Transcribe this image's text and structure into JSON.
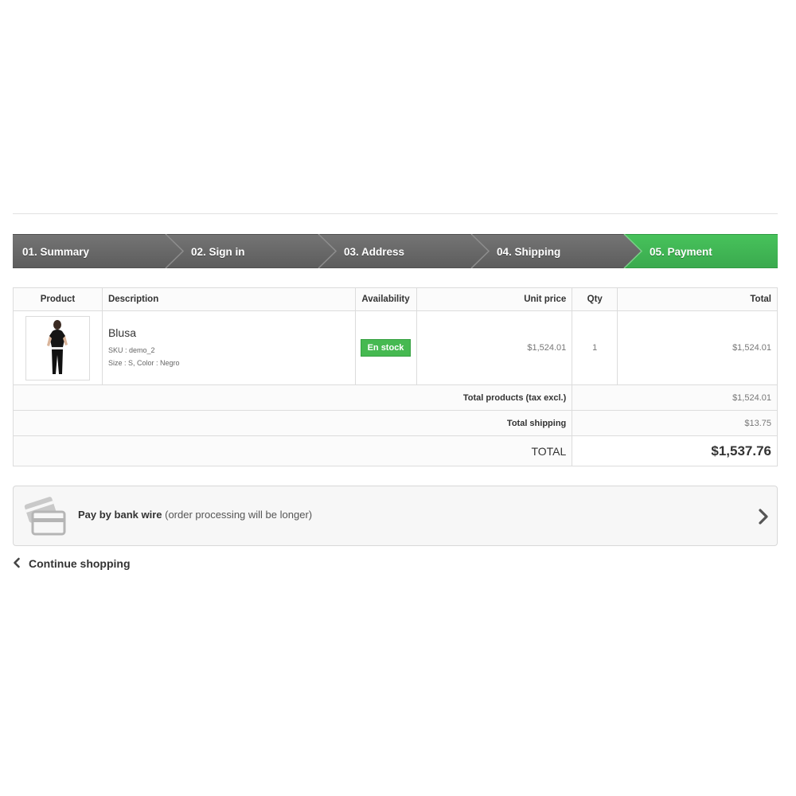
{
  "steps": [
    {
      "label": "01. Summary"
    },
    {
      "label": "02. Sign in"
    },
    {
      "label": "03. Address"
    },
    {
      "label": "04. Shipping"
    },
    {
      "label": "05. Payment",
      "active": true
    }
  ],
  "table": {
    "headers": {
      "product": "Product",
      "description": "Description",
      "availability": "Availability",
      "unit_price": "Unit price",
      "qty": "Qty",
      "total": "Total"
    },
    "item": {
      "name": "Blusa",
      "sku": "SKU : demo_2",
      "attributes": "Size : S, Color : Negro",
      "availability": "En stock",
      "unit_price": "$1,524.01",
      "qty": "1",
      "total": "$1,524.01"
    },
    "totals": {
      "products_label": "Total products (tax excl.)",
      "products_value": "$1,524.01",
      "shipping_label": "Total shipping",
      "shipping_value": "$13.75",
      "grand_label": "TOTAL",
      "grand_value": "$1,537.76"
    }
  },
  "payment": {
    "method": "Pay by bank wire",
    "note": "(order processing will be longer)",
    "icon": "bank-card-icon"
  },
  "continue_shopping": "Continue shopping",
  "colors": {
    "step_bg": "#666666",
    "step_active": "#46b951",
    "stock_badge": "#46b951"
  }
}
